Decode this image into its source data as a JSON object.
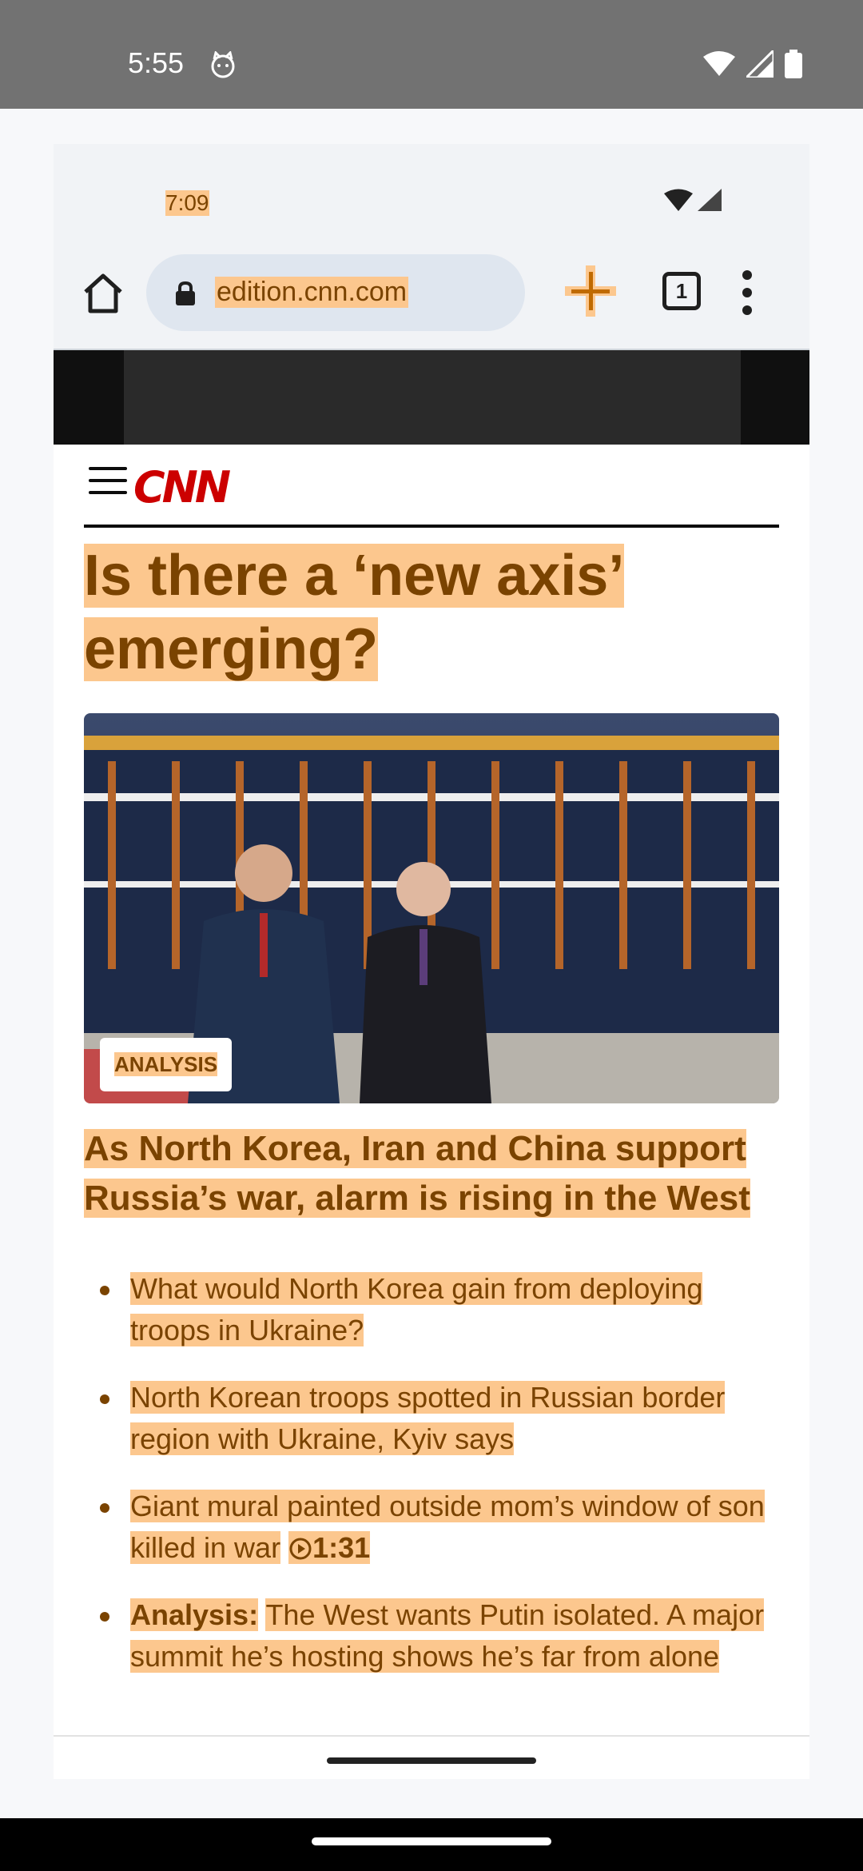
{
  "system": {
    "time": "5:55",
    "icons": [
      "cat-icon",
      "wifi-icon",
      "signal-icon",
      "battery-icon"
    ]
  },
  "screenshot": {
    "status_time": "7:09",
    "browser": {
      "url": "edition.cnn.com",
      "tab_count": "1",
      "icons": [
        "home-icon",
        "lock-icon",
        "new-tab-plus-icon",
        "tab-switcher-icon",
        "more-vert-icon"
      ]
    },
    "site": {
      "logo_text": "CNN",
      "headline": "Is there a ‘new axis’ emerging?",
      "hero_tag": "ANALYSIS",
      "subhead": "As North Korea, Iran and China support Russia’s war, alarm is rising in the West",
      "bullets": [
        {
          "text": "What would North Korea gain from deploying troops in Ukraine?"
        },
        {
          "text": "North Korean troops spotted in Russian border region with Ukraine, Kyiv says"
        },
        {
          "text": "Giant mural painted outside mom’s window of son killed in war",
          "duration": "1:31"
        },
        {
          "prefix": "Analysis:",
          "text": "The West wants Putin isolated. A major summit he’s hosting shows he’s far from alone"
        }
      ]
    }
  },
  "colors": {
    "highlight": "#fcc78e",
    "highlight_text": "#7a4300",
    "cnn_red": "#cc0000",
    "status_bar": "#727272"
  }
}
